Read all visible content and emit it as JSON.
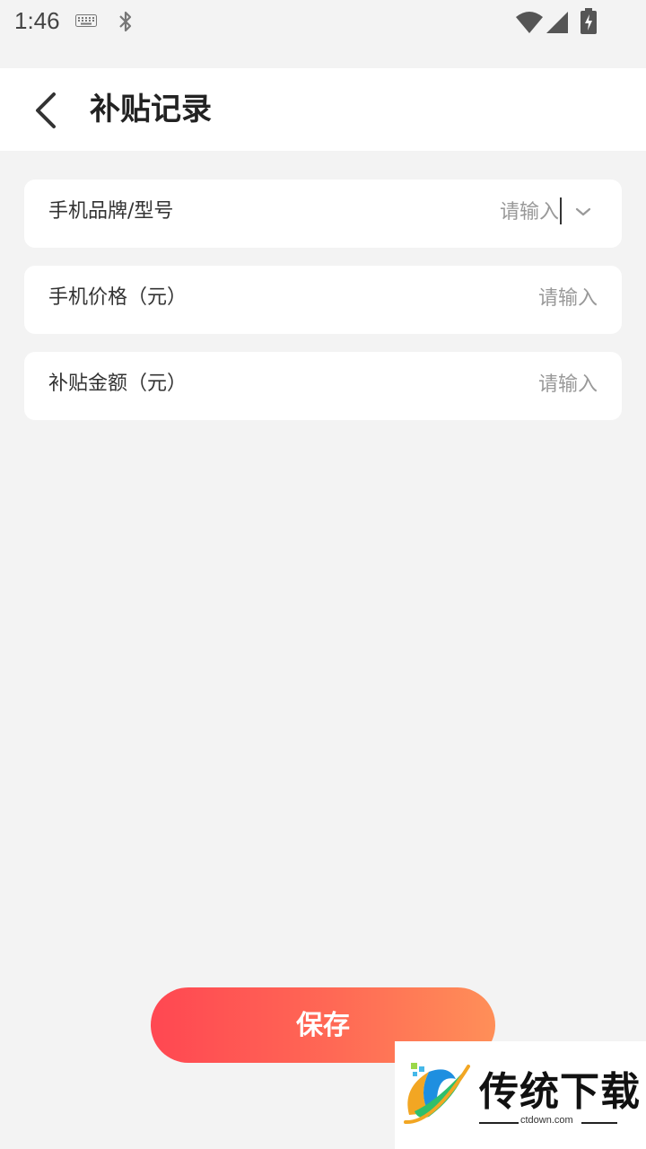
{
  "status_bar": {
    "time": "1:46",
    "icons": [
      "keyboard-icon",
      "bluetooth-icon",
      "wifi-icon",
      "signal-icon",
      "battery-charging-icon"
    ]
  },
  "header": {
    "title": "补贴记录",
    "back_icon": "chevron-left-icon"
  },
  "form": {
    "fields": [
      {
        "label": "手机品牌/型号",
        "placeholder": "请输入",
        "value": "",
        "has_dropdown": true,
        "dropdown_icon": "chevron-down-icon"
      },
      {
        "label": "手机价格（元）",
        "placeholder": "请输入",
        "value": ""
      },
      {
        "label": "补贴金额（元）",
        "placeholder": "请输入",
        "value": ""
      }
    ]
  },
  "actions": {
    "save_label": "保存"
  },
  "watermark": {
    "title": "传统下载",
    "url": "ctdown.com"
  },
  "colors": {
    "background": "#f3f3f3",
    "card": "#ffffff",
    "accent_start": "#ff4752",
    "accent_end": "#ff8f58",
    "placeholder": "#999999"
  }
}
